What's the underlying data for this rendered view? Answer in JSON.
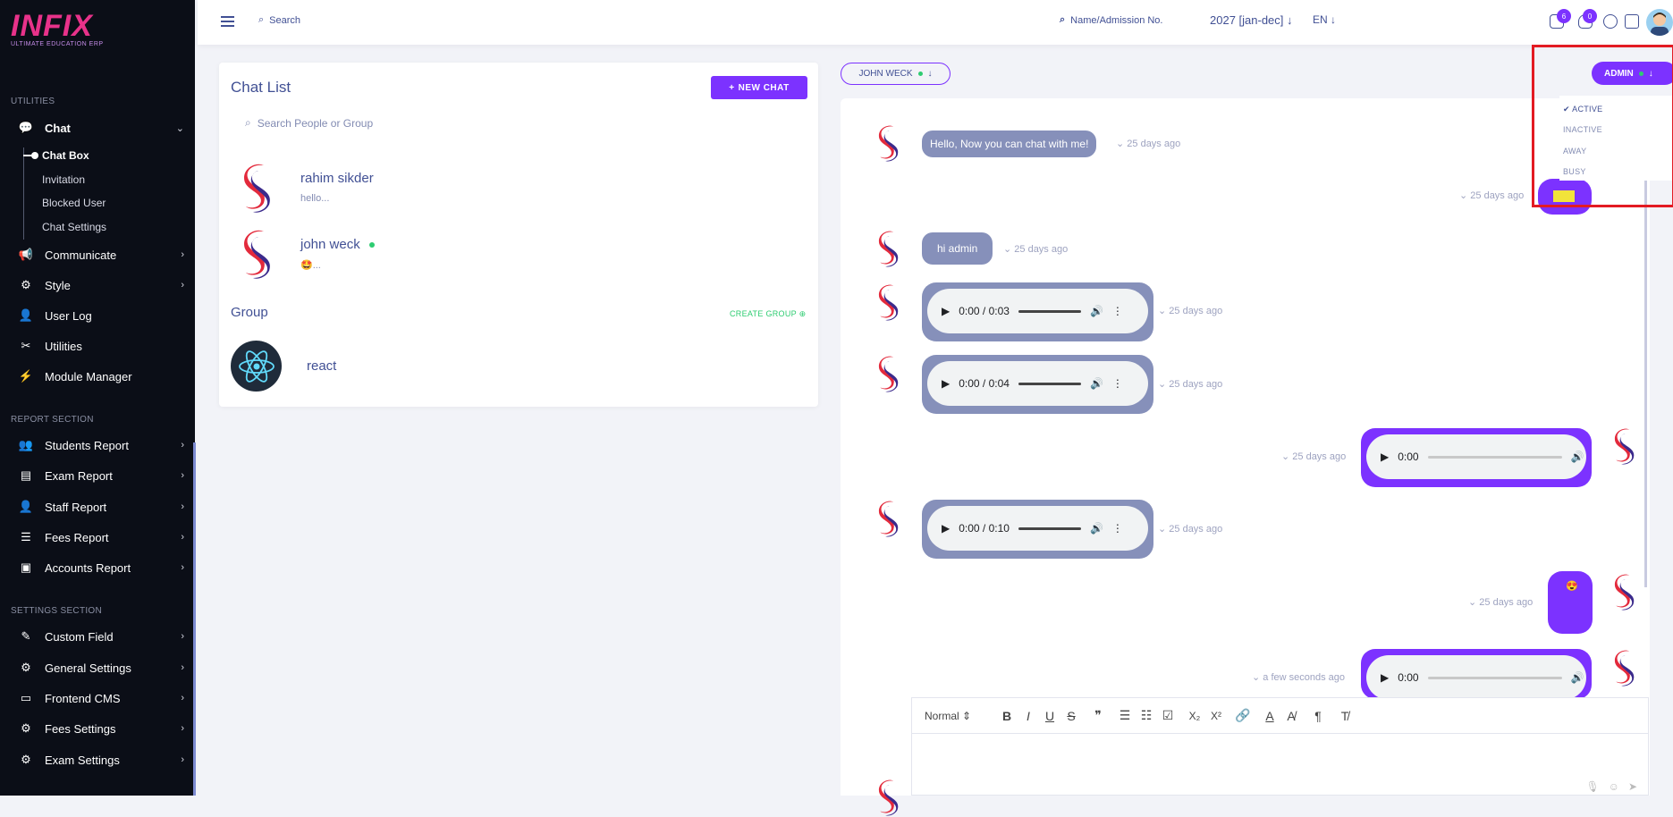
{
  "brand": {
    "logo_text": "INFIX",
    "tagline": "ULTIMATE EDUCATION ERP"
  },
  "sidebar": {
    "sections": {
      "utilities": "UTILITIES",
      "report": "REPORT SECTION",
      "settings": "SETTINGS SECTION"
    },
    "items": [
      {
        "label": "Chat"
      },
      {
        "label": "Communicate"
      },
      {
        "label": "Style"
      },
      {
        "label": "User Log"
      },
      {
        "label": "Utilities"
      },
      {
        "label": "Module Manager"
      },
      {
        "label": "Students Report"
      },
      {
        "label": "Exam Report"
      },
      {
        "label": "Staff Report"
      },
      {
        "label": "Fees Report"
      },
      {
        "label": "Accounts Report"
      },
      {
        "label": "Custom Field"
      },
      {
        "label": "General Settings"
      },
      {
        "label": "Frontend CMS"
      },
      {
        "label": "Fees Settings"
      },
      {
        "label": "Exam Settings"
      }
    ],
    "chat_sub": [
      "Chat Box",
      "Invitation",
      "Blocked User",
      "Chat Settings"
    ]
  },
  "topbar": {
    "search_placeholder": "Search",
    "name_search": "Name/Admission No.",
    "session": "2027 [jan-dec]",
    "lang": "EN",
    "messages_count": "6",
    "notifications_count": "0"
  },
  "chat_list": {
    "title": "Chat List",
    "new_chat": "NEW CHAT",
    "search_placeholder": "Search People or Group",
    "people": [
      {
        "name": "rahim sikder",
        "last": "hello..."
      },
      {
        "name": "john weck",
        "last": "🤩..."
      }
    ],
    "group_title": "Group",
    "create_group": "CREATE GROUP",
    "groups": [
      {
        "name": "react"
      }
    ]
  },
  "conversation": {
    "partner": "JOHN WECK",
    "me": "ADMIN",
    "status_options": [
      "ACTIVE",
      "INACTIVE",
      "AWAY",
      "BUSY"
    ],
    "messages": [
      {
        "text": "Hello, Now you can chat with me!",
        "time": "25 days ago"
      },
      {
        "time": "25 days ago"
      },
      {
        "text": "hi admin",
        "time": "25 days ago"
      },
      {
        "audio": "0:00 / 0:03",
        "time": "25 days ago"
      },
      {
        "audio": "0:00 / 0:04",
        "time": "25 days ago"
      },
      {
        "audio": "0:00",
        "time": "25 days ago"
      },
      {
        "audio": "0:00 / 0:10",
        "time": "25 days ago"
      },
      {
        "time": "25 days ago"
      },
      {
        "audio": "0:00",
        "time": "a few seconds ago"
      }
    ]
  },
  "editor": {
    "format": "Normal"
  }
}
